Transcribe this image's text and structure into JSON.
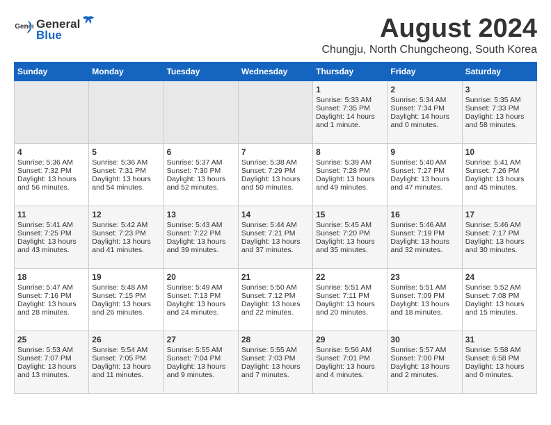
{
  "logo": {
    "general": "General",
    "blue": "Blue"
  },
  "title": "August 2024",
  "subtitle": "Chungju, North Chungcheong, South Korea",
  "days_of_week": [
    "Sunday",
    "Monday",
    "Tuesday",
    "Wednesday",
    "Thursday",
    "Friday",
    "Saturday"
  ],
  "weeks": [
    [
      {
        "day": "",
        "info": ""
      },
      {
        "day": "",
        "info": ""
      },
      {
        "day": "",
        "info": ""
      },
      {
        "day": "",
        "info": ""
      },
      {
        "day": "1",
        "info": "Sunrise: 5:33 AM\nSunset: 7:35 PM\nDaylight: 14 hours\nand 1 minute."
      },
      {
        "day": "2",
        "info": "Sunrise: 5:34 AM\nSunset: 7:34 PM\nDaylight: 14 hours\nand 0 minutes."
      },
      {
        "day": "3",
        "info": "Sunrise: 5:35 AM\nSunset: 7:33 PM\nDaylight: 13 hours\nand 58 minutes."
      }
    ],
    [
      {
        "day": "4",
        "info": "Sunrise: 5:36 AM\nSunset: 7:32 PM\nDaylight: 13 hours\nand 56 minutes."
      },
      {
        "day": "5",
        "info": "Sunrise: 5:36 AM\nSunset: 7:31 PM\nDaylight: 13 hours\nand 54 minutes."
      },
      {
        "day": "6",
        "info": "Sunrise: 5:37 AM\nSunset: 7:30 PM\nDaylight: 13 hours\nand 52 minutes."
      },
      {
        "day": "7",
        "info": "Sunrise: 5:38 AM\nSunset: 7:29 PM\nDaylight: 13 hours\nand 50 minutes."
      },
      {
        "day": "8",
        "info": "Sunrise: 5:39 AM\nSunset: 7:28 PM\nDaylight: 13 hours\nand 49 minutes."
      },
      {
        "day": "9",
        "info": "Sunrise: 5:40 AM\nSunset: 7:27 PM\nDaylight: 13 hours\nand 47 minutes."
      },
      {
        "day": "10",
        "info": "Sunrise: 5:41 AM\nSunset: 7:26 PM\nDaylight: 13 hours\nand 45 minutes."
      }
    ],
    [
      {
        "day": "11",
        "info": "Sunrise: 5:41 AM\nSunset: 7:25 PM\nDaylight: 13 hours\nand 43 minutes."
      },
      {
        "day": "12",
        "info": "Sunrise: 5:42 AM\nSunset: 7:23 PM\nDaylight: 13 hours\nand 41 minutes."
      },
      {
        "day": "13",
        "info": "Sunrise: 5:43 AM\nSunset: 7:22 PM\nDaylight: 13 hours\nand 39 minutes."
      },
      {
        "day": "14",
        "info": "Sunrise: 5:44 AM\nSunset: 7:21 PM\nDaylight: 13 hours\nand 37 minutes."
      },
      {
        "day": "15",
        "info": "Sunrise: 5:45 AM\nSunset: 7:20 PM\nDaylight: 13 hours\nand 35 minutes."
      },
      {
        "day": "16",
        "info": "Sunrise: 5:46 AM\nSunset: 7:19 PM\nDaylight: 13 hours\nand 32 minutes."
      },
      {
        "day": "17",
        "info": "Sunrise: 5:46 AM\nSunset: 7:17 PM\nDaylight: 13 hours\nand 30 minutes."
      }
    ],
    [
      {
        "day": "18",
        "info": "Sunrise: 5:47 AM\nSunset: 7:16 PM\nDaylight: 13 hours\nand 28 minutes."
      },
      {
        "day": "19",
        "info": "Sunrise: 5:48 AM\nSunset: 7:15 PM\nDaylight: 13 hours\nand 26 minutes."
      },
      {
        "day": "20",
        "info": "Sunrise: 5:49 AM\nSunset: 7:13 PM\nDaylight: 13 hours\nand 24 minutes."
      },
      {
        "day": "21",
        "info": "Sunrise: 5:50 AM\nSunset: 7:12 PM\nDaylight: 13 hours\nand 22 minutes."
      },
      {
        "day": "22",
        "info": "Sunrise: 5:51 AM\nSunset: 7:11 PM\nDaylight: 13 hours\nand 20 minutes."
      },
      {
        "day": "23",
        "info": "Sunrise: 5:51 AM\nSunset: 7:09 PM\nDaylight: 13 hours\nand 18 minutes."
      },
      {
        "day": "24",
        "info": "Sunrise: 5:52 AM\nSunset: 7:08 PM\nDaylight: 13 hours\nand 15 minutes."
      }
    ],
    [
      {
        "day": "25",
        "info": "Sunrise: 5:53 AM\nSunset: 7:07 PM\nDaylight: 13 hours\nand 13 minutes."
      },
      {
        "day": "26",
        "info": "Sunrise: 5:54 AM\nSunset: 7:05 PM\nDaylight: 13 hours\nand 11 minutes."
      },
      {
        "day": "27",
        "info": "Sunrise: 5:55 AM\nSunset: 7:04 PM\nDaylight: 13 hours\nand 9 minutes."
      },
      {
        "day": "28",
        "info": "Sunrise: 5:55 AM\nSunset: 7:03 PM\nDaylight: 13 hours\nand 7 minutes."
      },
      {
        "day": "29",
        "info": "Sunrise: 5:56 AM\nSunset: 7:01 PM\nDaylight: 13 hours\nand 4 minutes."
      },
      {
        "day": "30",
        "info": "Sunrise: 5:57 AM\nSunset: 7:00 PM\nDaylight: 13 hours\nand 2 minutes."
      },
      {
        "day": "31",
        "info": "Sunrise: 5:58 AM\nSunset: 6:58 PM\nDaylight: 13 hours\nand 0 minutes."
      }
    ]
  ]
}
